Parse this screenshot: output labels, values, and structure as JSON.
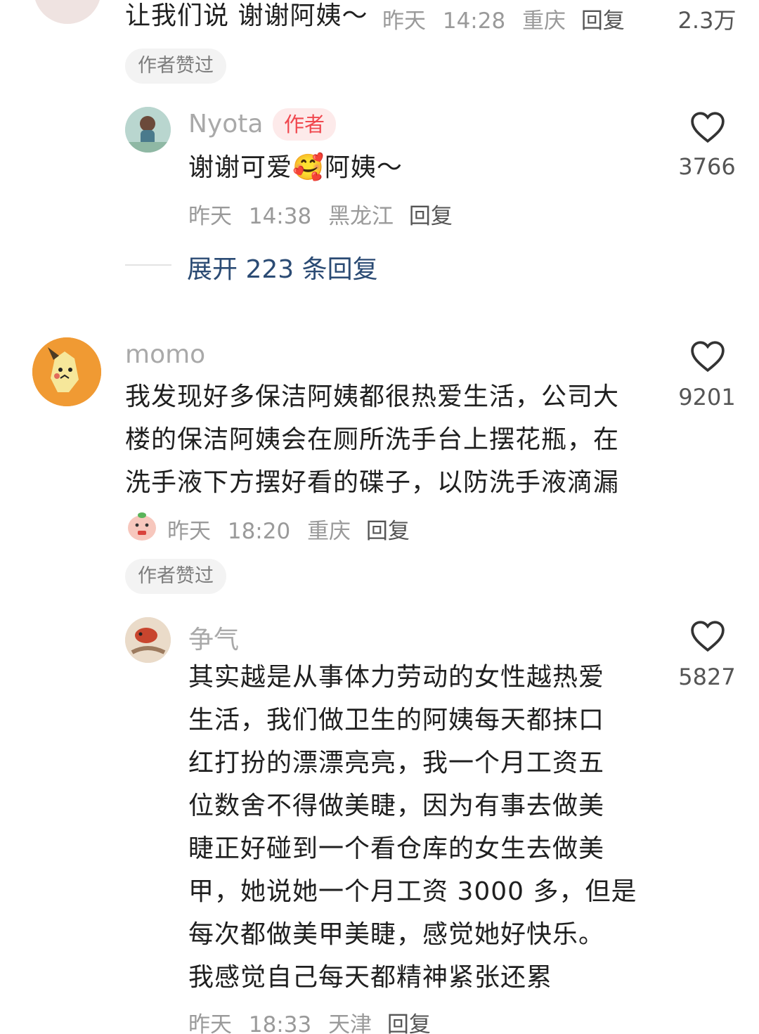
{
  "comment_top": {
    "text": "让我们说 谢谢阿姨～",
    "date": "昨天",
    "time": "14:28",
    "location": "重庆",
    "reply_label": "回复",
    "likes": "2.3万",
    "liked_badge": "作者赞过"
  },
  "reply_nyota": {
    "username": "Nyota",
    "author_tag": "作者",
    "text_before_emoji": "谢谢可爱",
    "emoji": "🥰",
    "text_after_emoji": "阿姨～",
    "date": "昨天",
    "time": "14:38",
    "location": "黑龙江",
    "reply_label": "回复",
    "likes": "3766",
    "expand_label": "展开 223 条回复"
  },
  "comment_momo": {
    "username": "momo",
    "lines": [
      "我发现好多保洁阿姨都很热爱生活，公司大",
      "楼的保洁阿姨会在厕所洗手台上摆花瓶，在",
      "洗手液下方摆好看的碟子，以防洗手液滴漏"
    ],
    "date": "昨天",
    "time": "18:20",
    "location": "重庆",
    "reply_label": "回复",
    "likes": "9201",
    "liked_badge": "作者赞过"
  },
  "reply_zhengqi": {
    "username": "争气",
    "lines": [
      "其实越是从事体力劳动的女性越热爱",
      "生活，我们做卫生的阿姨每天都抹口",
      "红打扮的漂漂亮亮，我一个月工资五",
      "位数舍不得做美睫，因为有事去做美",
      "睫正好碰到一个看仓库的女生去做美",
      "甲，她说她一个月工资 3000 多，但是",
      "每次都做美甲美睫，感觉她好快乐。",
      "我感觉自己每天都精神紧张还累"
    ],
    "date": "昨天",
    "time": "18:33",
    "location": "天津",
    "reply_label": "回复",
    "likes": "5827"
  },
  "colors": {
    "author_tag_text": "#f0484f",
    "author_tag_bg": "#fdeaea",
    "expand_link": "#2b4b74"
  },
  "icons": [
    "avatar",
    "heart-icon",
    "sticker-icon"
  ]
}
